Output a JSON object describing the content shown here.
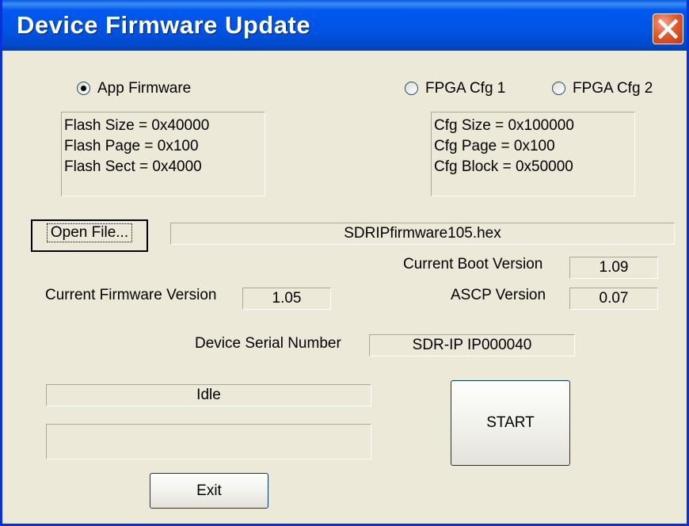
{
  "window": {
    "title": "Device Firmware Update"
  },
  "modes": {
    "app": {
      "label": "App  Firmware",
      "selected": true
    },
    "fpga1": {
      "label": "FPGA Cfg 1",
      "selected": false
    },
    "fpga2": {
      "label": "FPGA Cfg 2",
      "selected": false
    }
  },
  "flash_info": [
    "Flash Size = 0x40000",
    "Flash Page = 0x100",
    "Flash Sect = 0x4000"
  ],
  "cfg_info": [
    "Cfg Size = 0x100000",
    "Cfg Page = 0x100",
    "Cfg Block = 0x50000"
  ],
  "file": {
    "button_label": "Open File...",
    "filename": "SDRIPfirmware105.hex"
  },
  "versions": {
    "boot_label": "Current Boot Version",
    "boot_value": "1.09",
    "firmware_label": "Current Firmware Version",
    "firmware_value": "1.05",
    "ascp_label": "ASCP Version",
    "ascp_value": "0.07"
  },
  "serial": {
    "label": "Device Serial Number",
    "value": "SDR-IP  IP000040"
  },
  "status": {
    "text": "Idle",
    "detail": ""
  },
  "actions": {
    "start_label": "START",
    "exit_label": "Exit"
  }
}
